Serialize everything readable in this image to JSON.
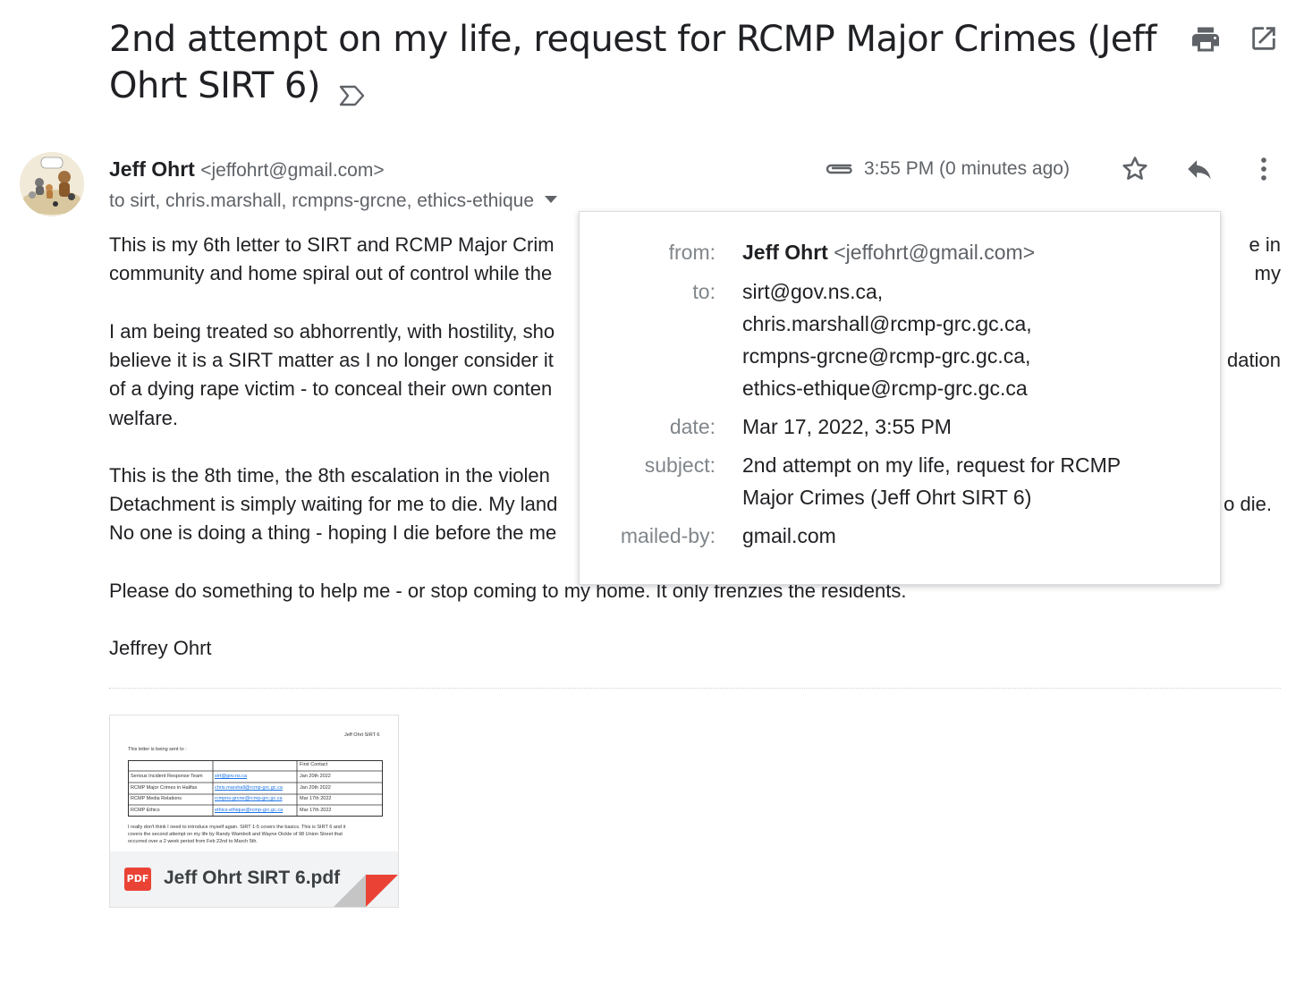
{
  "email": {
    "subject": "2nd attempt on my life, request for RCMP Major Crimes (Jeff Ohrt SIRT 6)",
    "sender_name": "Jeff Ohrt",
    "sender_email": "<jeffohrt@gmail.com>",
    "recipients_summary": "to sirt, chris.marshall, rcmpns-grcne, ethics-ethique",
    "time": "3:55 PM (0 minutes ago)",
    "icons": {
      "important": "important-marker-icon",
      "print": "print-icon",
      "open_new_window": "open-in-new-window-icon",
      "attachment": "paperclip-icon",
      "star": "star-icon",
      "reply": "reply-icon",
      "more": "more-vert-icon",
      "dropdown": "caret-down-icon"
    },
    "body": [
      "This is my 6th letter to SIRT and RCMP Major Crim",
      "e in my",
      "community and home spiral out of control while the",
      "I am being treated so abhorrently, with hostility, sho",
      "believe it is a SIRT matter as I no longer consider it",
      "dation",
      "of a dying rape victim - to conceal their own conten",
      "welfare.",
      "This is the 8th time, the 8th escalation in the violen",
      "Detachment is simply waiting for me to die. My land",
      "o die.",
      "No one is doing a thing - hoping I die before the me",
      "Please do something to help me - or stop coming to my home.  It only frenzies the residents.",
      "Jeffrey Ohrt"
    ]
  },
  "details_popup": {
    "from_label": "from:",
    "from_name": "Jeff Ohrt",
    "from_email": "<jeffohrt@gmail.com>",
    "to_label": "to:",
    "to_lines": [
      "sirt@gov.ns.ca,",
      "chris.marshall@rcmp-grc.gc.ca,",
      "rcmpns-grcne@rcmp-grc.gc.ca,",
      "ethics-ethique@rcmp-grc.gc.ca"
    ],
    "date_label": "date:",
    "date": "Mar 17, 2022, 3:55 PM",
    "subject_label": "subject:",
    "subject_lines": [
      "2nd attempt on my life, request for RCMP",
      "Major Crimes (Jeff Ohrt SIRT 6)"
    ],
    "mailedby_label": "mailed-by:",
    "mailedby": "gmail.com"
  },
  "attachment": {
    "file_name": "Jeff Ohrt SIRT 6.pdf",
    "badge": "PDF",
    "preview": {
      "header_right": "Jeff Ohrt SIRT 6",
      "intro": "This letter is being sent to :",
      "table_header": "First Contact",
      "rows": [
        {
          "name": "Serious Incident Response Team",
          "email": "sirt@gov.ns.ca",
          "date": "Jan 20th 2022"
        },
        {
          "name": "RCMP Major Crimes in Halifax",
          "email": "chris.marshall@rcmp-grc.gc.ca",
          "date": "Jan 20th 2022"
        },
        {
          "name": "RCMP Media Relations",
          "email": "rcmpns-grcne@rcmp-grc.gc.ca",
          "date": "Mar 17th 2022"
        },
        {
          "name": "RCMP Ethics",
          "email": "ethics-ethique@rcmp-grc.gc.ca",
          "date": "Mar 17th 2022"
        }
      ],
      "paragraph": [
        "I really don't think I need to introduce myself again.  SIRT 1-5 covers the basics.  This is SIRT 6 and it",
        "covers the second attempt on my life by Randy Wambolt and Wayne Oickle of 98 Union Street that",
        "occurred over a 2 week period from Feb 22nd to March 5th."
      ]
    }
  },
  "colors": {
    "text": "#202124",
    "secondary": "#5f6368",
    "pdf_red": "#ea4335",
    "link_blue": "#1a73e8"
  }
}
